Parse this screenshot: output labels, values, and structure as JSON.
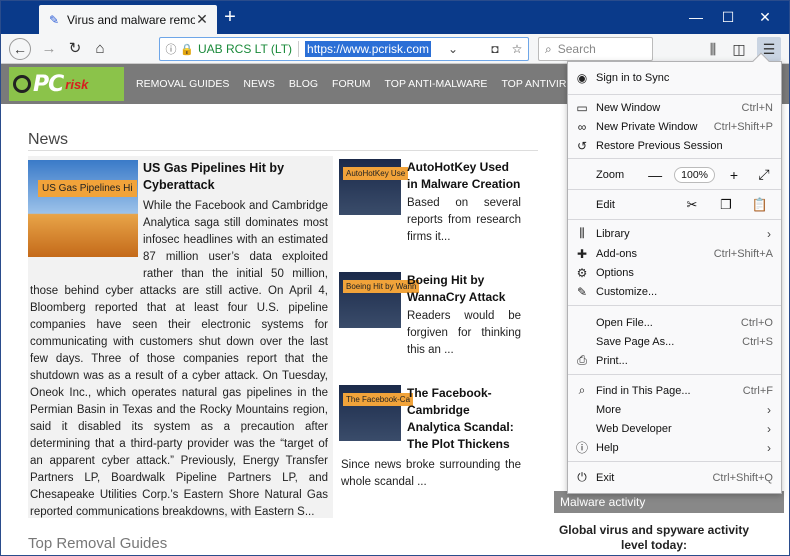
{
  "tab": {
    "title": "Virus and malware removal inst",
    "favicon": "pcrisk-favicon-icon"
  },
  "window": {
    "minimize": "—",
    "maximize": "☐",
    "close": "✕"
  },
  "nav": {
    "identity": "UAB RCS LT (LT)",
    "url": "https://www.pcrisk.com",
    "search_placeholder": "Search"
  },
  "site": {
    "logo_main": "PC",
    "logo_sub": "risk",
    "nav_items": [
      "REMOVAL GUIDES",
      "NEWS",
      "BLOG",
      "FORUM",
      "TOP ANTI-MALWARE",
      "TOP ANTIVIRUS 2018",
      "WE"
    ],
    "news_heading": "News",
    "featured": {
      "thumb_label": "US Gas Pipelines Hi",
      "title": "US Gas Pipelines Hit by Cyberattack",
      "body": "While the Facebook and Cambridge Analytica saga still dominates most infosec headlines with an estimated 87 million user’s data exploited rather than the initial 50 million, those behind cyber attacks are still active. On April 4, Bloomberg reported that at least four U.S. pipeline companies have seen their electronic systems for communicating with customers shut down over the last few days. Three of those companies report that the shutdown was as a result of a cyber attack.  On Tuesday, Oneok Inc., which operates natural gas pipelines in the Permian Basin in Texas and the Rocky Mountains region, said it disabled its system as a precaution after determining that a third-party provider was the “target of an apparent cyber attack.” Previously, Energy Transfer Partners LP, Boardwalk Pipeline Partners LP, and Chesapeake Utilities Corp.’s Eastern Shore Natural Gas reported communications breakdowns, with Eastern S..."
    },
    "stories": [
      {
        "thumb_label": "AutoHotKey Use",
        "title": "AutoHotKey Used in Malware Creation",
        "text": "Based on several reports from research firms it..."
      },
      {
        "thumb_label": "Boeing Hit by Wann",
        "title": "Boeing Hit by WannaCry Attack",
        "text": "Readers would be forgiven for thinking this an ..."
      },
      {
        "thumb_label": "The Facebook-Ca",
        "title": "The Facebook-Cambridge Analytica Scandal: The Plot Thickens",
        "text": "Since news broke surrounding the whole scandal ..."
      }
    ],
    "top_removal": "Top Removal Guides",
    "malware_activity": "Malware activity",
    "global_virus": "Global virus and spyware activity level today:"
  },
  "menu": {
    "sign_in": "Sign in to Sync",
    "new_window": {
      "label": "New Window",
      "shortcut": "Ctrl+N"
    },
    "new_private": {
      "label": "New Private Window",
      "shortcut": "Ctrl+Shift+P"
    },
    "restore": {
      "label": "Restore Previous Session"
    },
    "zoom": {
      "label": "Zoom",
      "value": "100%",
      "minus": "—",
      "plus": "+"
    },
    "edit": {
      "label": "Edit"
    },
    "library": {
      "label": "Library"
    },
    "addons": {
      "label": "Add-ons",
      "shortcut": "Ctrl+Shift+A"
    },
    "options": {
      "label": "Options"
    },
    "customize": {
      "label": "Customize..."
    },
    "open_file": {
      "label": "Open File...",
      "shortcut": "Ctrl+O"
    },
    "save_page": {
      "label": "Save Page As...",
      "shortcut": "Ctrl+S"
    },
    "print": {
      "label": "Print..."
    },
    "find": {
      "label": "Find in This Page...",
      "shortcut": "Ctrl+F"
    },
    "more": {
      "label": "More"
    },
    "web_developer": {
      "label": "Web Developer"
    },
    "help": {
      "label": "Help"
    },
    "exit": {
      "label": "Exit",
      "shortcut": "Ctrl+Shift+Q"
    }
  }
}
